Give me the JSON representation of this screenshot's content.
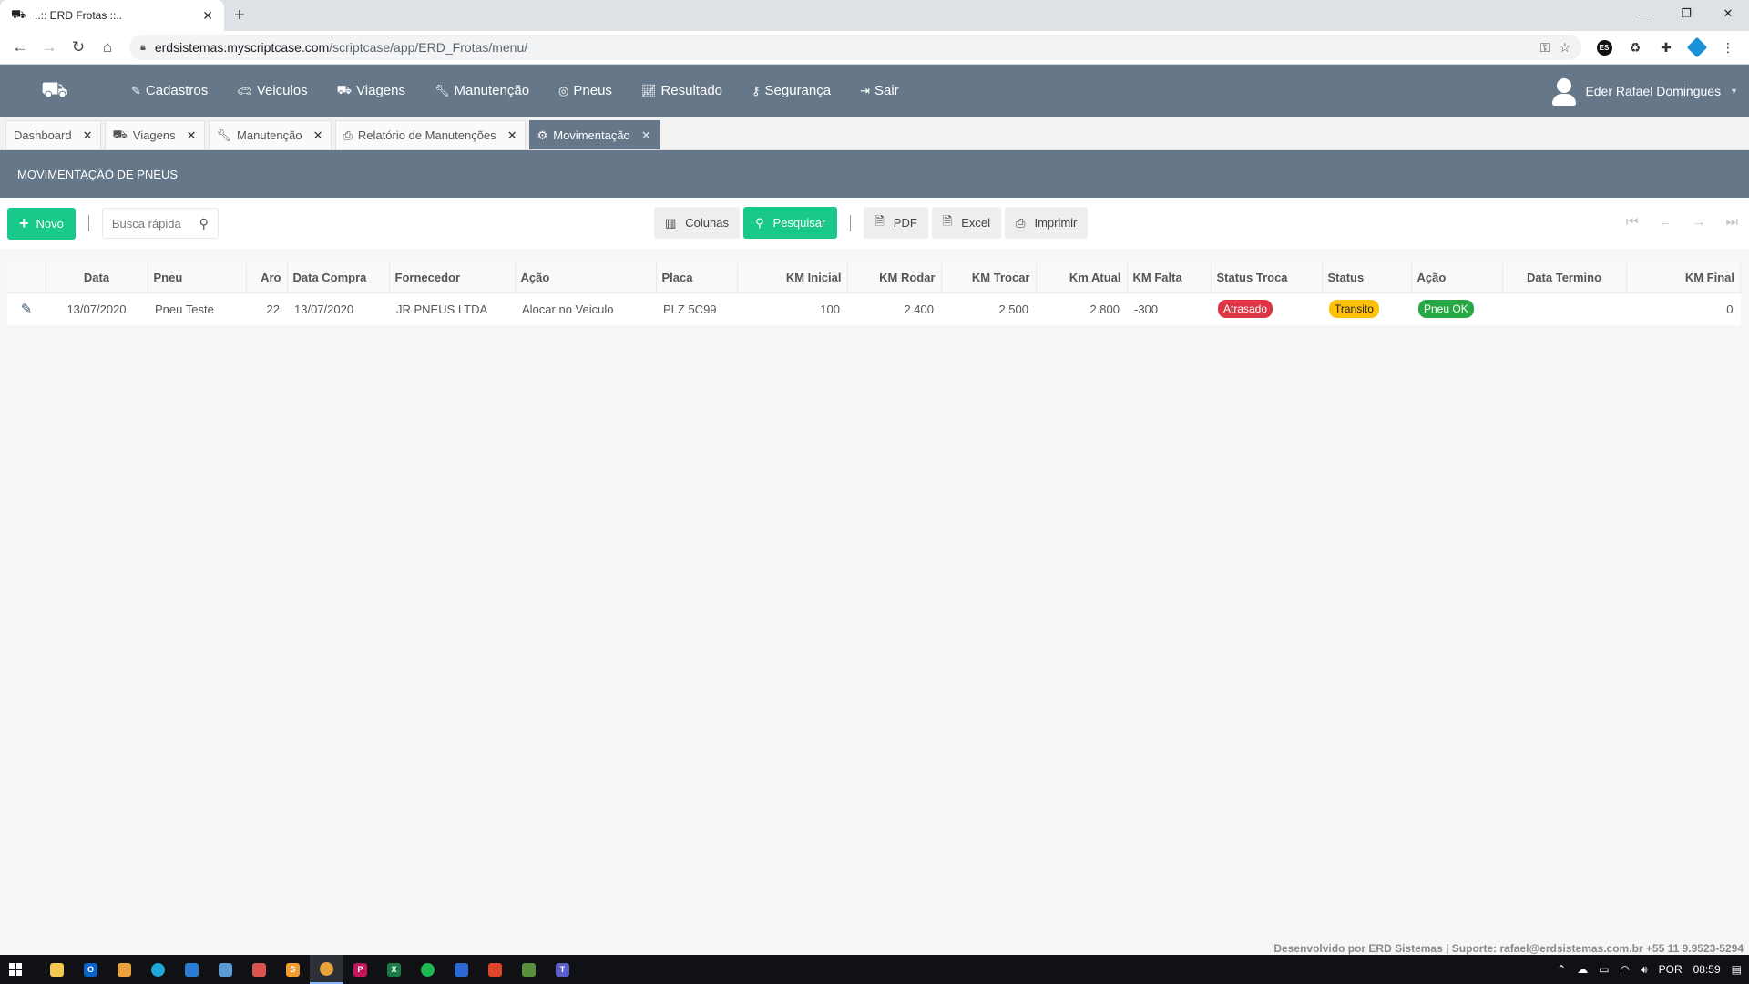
{
  "browser": {
    "tab_title": "..:: ERD Frotas ::..",
    "url_domain": "erdsistemas.myscriptcase.com",
    "url_path": "/scriptcase/app/ERD_Frotas/menu/"
  },
  "nav": {
    "items": [
      {
        "label": "Cadastros",
        "icon": "edit-icon"
      },
      {
        "label": "Veiculos",
        "icon": "car-icon"
      },
      {
        "label": "Viagens",
        "icon": "truck-icon"
      },
      {
        "label": "Manutenção",
        "icon": "wrench-icon"
      },
      {
        "label": "Pneus",
        "icon": "tire-icon"
      },
      {
        "label": "Resultado",
        "icon": "chart-icon"
      },
      {
        "label": "Segurança",
        "icon": "key-icon"
      },
      {
        "label": "Sair",
        "icon": "sign-out-icon"
      }
    ],
    "user_name": "Eder Rafael Domingues"
  },
  "app_tabs": [
    {
      "label": "Dashboard",
      "icon": ""
    },
    {
      "label": "Viagens",
      "icon": "truck-icon"
    },
    {
      "label": "Manutenção",
      "icon": "wrench-icon"
    },
    {
      "label": "Relatório de Manutenções",
      "icon": "print-icon"
    },
    {
      "label": "Movimentação",
      "icon": "tire-group-icon"
    }
  ],
  "page_title": "MOVIMENTAÇÃO DE PNEUS",
  "toolbar": {
    "new_label": "Novo",
    "quick_search_placeholder": "Busca rápida",
    "columns_label": "Colunas",
    "search_label": "Pesquisar",
    "pdf_label": "PDF",
    "excel_label": "Excel",
    "print_label": "Imprimir"
  },
  "table": {
    "headers": [
      "Data",
      "Pneu",
      "Aro",
      "Data Compra",
      "Fornecedor",
      "Ação",
      "Placa",
      "KM Inicial",
      "KM Rodar",
      "KM Trocar",
      "Km Atual",
      "KM Falta",
      "Status Troca",
      "Status",
      "Ação",
      "Data Termino",
      "KM Final"
    ],
    "rows": [
      {
        "data": "13/07/2020",
        "pneu": "Pneu Teste",
        "aro": "22",
        "data_compra": "13/07/2020",
        "fornecedor": "JR PNEUS LTDA",
        "acao": "Alocar no Veiculo",
        "placa": "PLZ 5C99",
        "km_inicial": "100",
        "km_rodar": "2.400",
        "km_trocar": "2.500",
        "km_atual": "2.800",
        "km_falta": "-300",
        "status_troca": "Atrasado",
        "status": "Transito",
        "acao2": "Pneu OK",
        "data_termino": "",
        "km_final": "0"
      }
    ]
  },
  "footer": "Desenvolvido por ERD Sistemas | Suporte: rafael@erdsistemas.com.br +55 11 9.9523-5294",
  "taskbar": {
    "lang": "POR",
    "time": "08:59"
  },
  "colors": {
    "header": "#66778a",
    "green": "#1ac98a",
    "badge_red": "#dc3545",
    "badge_yellow": "#ffc107",
    "badge_green": "#28a745"
  }
}
